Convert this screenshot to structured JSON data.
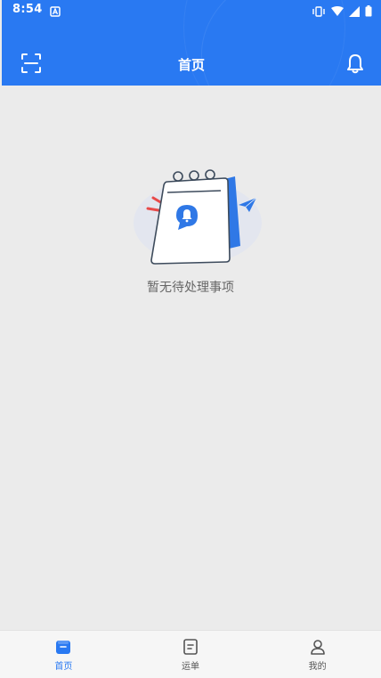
{
  "status_bar": {
    "time": "8:54"
  },
  "header": {
    "title": "首页",
    "scan_icon": "scan-icon",
    "bell_icon": "bell-icon"
  },
  "empty_state": {
    "message": "暂无待处理事项"
  },
  "bottom_nav": {
    "items": [
      {
        "label": "首页",
        "icon": "home-icon",
        "active": true
      },
      {
        "label": "运单",
        "icon": "waybill-icon",
        "active": false
      },
      {
        "label": "我的",
        "icon": "profile-icon",
        "active": false
      }
    ]
  },
  "colors": {
    "primary": "#2979f2",
    "background": "#ebebeb",
    "nav_background": "#f6f6f6",
    "text_muted": "#666666",
    "accent_red": "#e84a4a"
  }
}
